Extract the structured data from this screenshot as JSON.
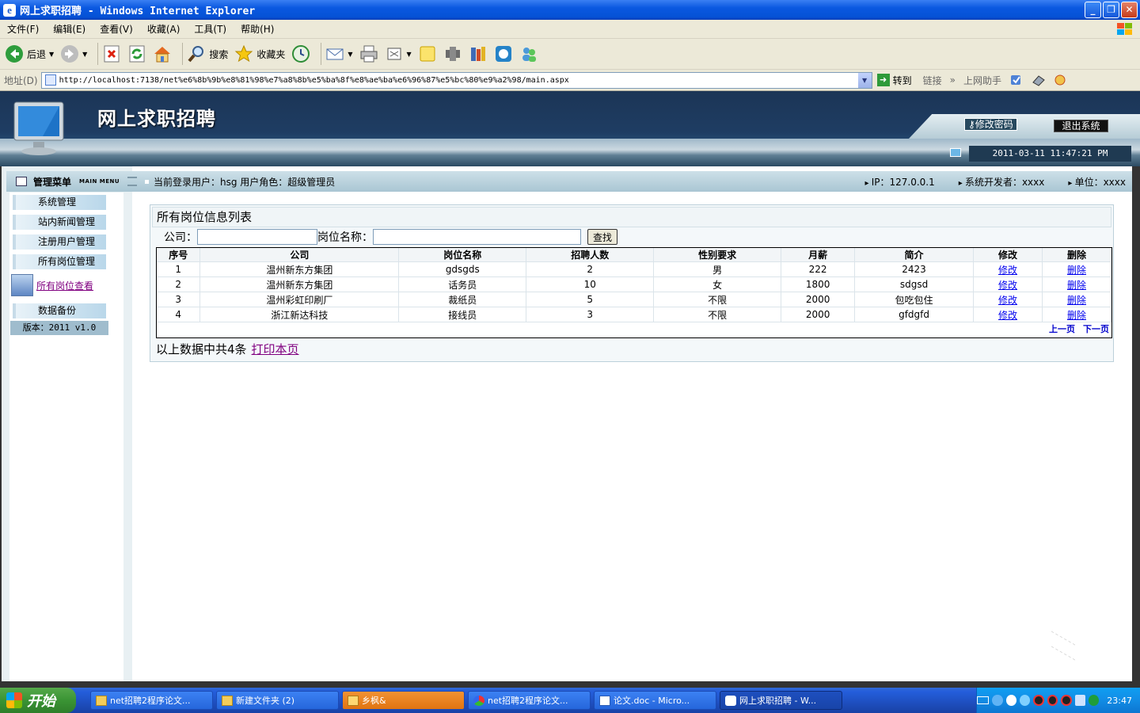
{
  "window": {
    "title": "网上求职招聘 - Windows Internet Explorer"
  },
  "menu": [
    "文件(F)",
    "编辑(E)",
    "查看(V)",
    "收藏(A)",
    "工具(T)",
    "帮助(H)"
  ],
  "toolbar": {
    "back": "后退",
    "search": "搜索",
    "favorites": "收藏夹"
  },
  "address": {
    "label": "地址(D)",
    "url": "http://localhost:7138/net%e6%8b%9b%e8%81%98%e7%a8%8b%e5%ba%8f%e8%ae%ba%e6%96%87%e5%bc%80%e9%a2%98/main.aspx",
    "go": "转到",
    "links": "链接",
    "helper": "上网助手"
  },
  "app": {
    "title": "网上求职招聘",
    "change_password": "修改密码",
    "logout": "退出系统",
    "datetime": "2011-03-11 11:47:21 PM"
  },
  "infobar": {
    "menu_title": "管理菜单",
    "menu_sub": "MAIN MENU",
    "user": "当前登录用户：hsg  用户角色：超级管理员",
    "ip": "IP：127.0.0.1",
    "developer": "系统开发者：xxxx",
    "unit": "单位：xxxx"
  },
  "sidebar": {
    "items": [
      "系统管理",
      "站内新闻管理",
      "注册用户管理",
      "所有岗位管理"
    ],
    "active_link": "所有岗位查看",
    "backup": "数据备份",
    "version": "版本：2011 v1.0"
  },
  "content": {
    "title": "所有岗位信息列表",
    "company_label": "公司：",
    "job_label": "岗位名称：",
    "search_btn": "查找",
    "columns": [
      "序号",
      "公司",
      "岗位名称",
      "招聘人数",
      "性别要求",
      "月薪",
      "简介",
      "修改",
      "删除"
    ],
    "rows": [
      [
        "1",
        "温州新东方集团",
        "gdsgds",
        "2",
        "男",
        "222",
        "2423",
        "修改",
        "删除"
      ],
      [
        "2",
        "温州新东方集团",
        "话务员",
        "10",
        "女",
        "1800",
        "sdgsd",
        "修改",
        "删除"
      ],
      [
        "3",
        "温州彩虹印刷厂",
        "裁纸员",
        "5",
        "不限",
        "2000",
        "包吃包住",
        "修改",
        "删除"
      ],
      [
        "4",
        "浙江新达科技",
        "接线员",
        "3",
        "不限",
        "2000",
        "gfdgfd",
        "修改",
        "删除"
      ]
    ],
    "prev": "上一页",
    "next": "下一页",
    "summary": "以上数据中共4条",
    "print": "打印本页"
  },
  "taskbar": {
    "start": "开始",
    "tasks": [
      "net招聘2程序论文...",
      "新建文件夹 (2)",
      "乡枫&",
      "net招聘2程序论文...",
      "论文.doc - Micro...",
      "网上求职招聘 - W..."
    ],
    "clock": "23:47"
  }
}
